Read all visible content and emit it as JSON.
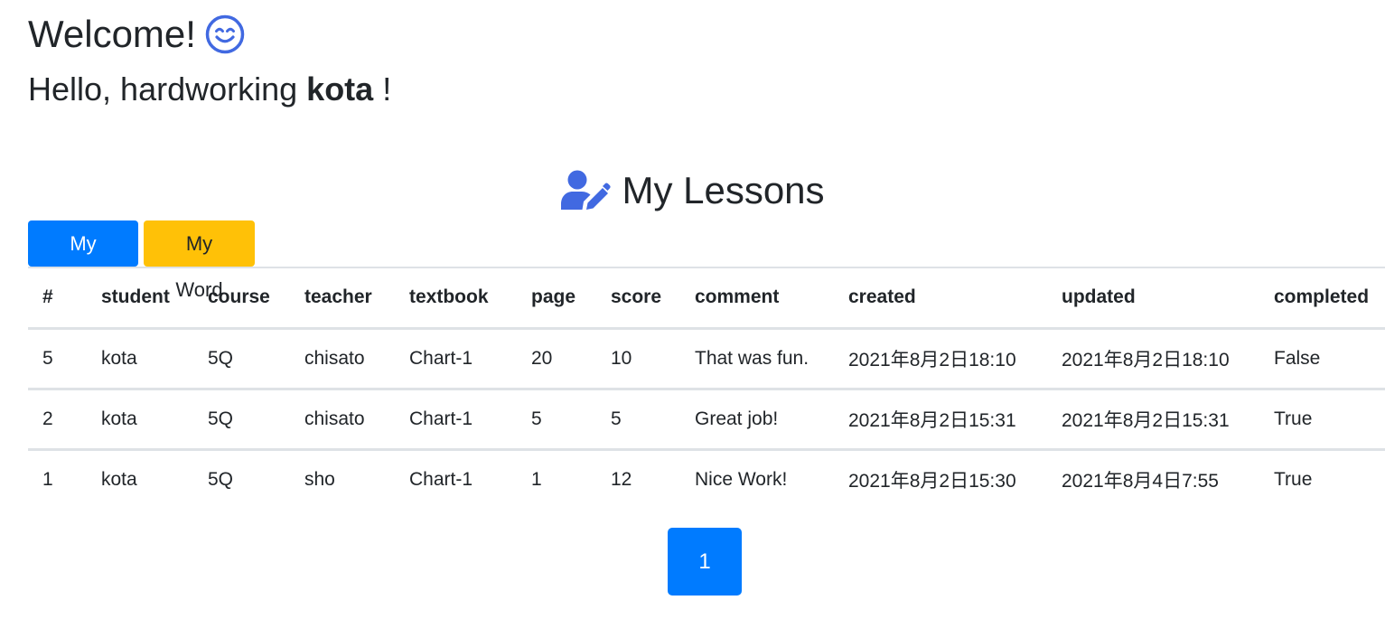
{
  "header": {
    "welcome": "Welcome!",
    "hello_prefix": "Hello, hardworking",
    "username": "kota",
    "hello_suffix": "!"
  },
  "lessons": {
    "title": "My Lessons",
    "buttons": {
      "chart": "My Chart",
      "word": "My Word"
    },
    "columns": [
      "#",
      "student",
      "course",
      "teacher",
      "textbook",
      "page",
      "score",
      "comment",
      "created",
      "updated",
      "completed"
    ],
    "rows": [
      [
        "5",
        "kota",
        "5Q",
        "chisato",
        "Chart-1",
        "20",
        "10",
        "That was fun.",
        "2021年8月2日18:10",
        "2021年8月2日18:10",
        "False"
      ],
      [
        "2",
        "kota",
        "5Q",
        "chisato",
        "Chart-1",
        "5",
        "5",
        "Great job!",
        "2021年8月2日15:31",
        "2021年8月2日15:31",
        "True"
      ],
      [
        "1",
        "kota",
        "5Q",
        "sho",
        "Chart-1",
        "1",
        "12",
        "Nice Work!",
        "2021年8月2日15:30",
        "2021年8月4日7:55",
        "True"
      ]
    ]
  },
  "pagination": {
    "current_page": "1"
  },
  "colors": {
    "primary": "#007bff",
    "warning": "#ffc107",
    "icon_blue": "#4169e1",
    "text": "#212529",
    "border": "#dee2e6"
  },
  "icons": {
    "welcome": "smiling-face-icon",
    "lessons": "user-edit-icon"
  }
}
